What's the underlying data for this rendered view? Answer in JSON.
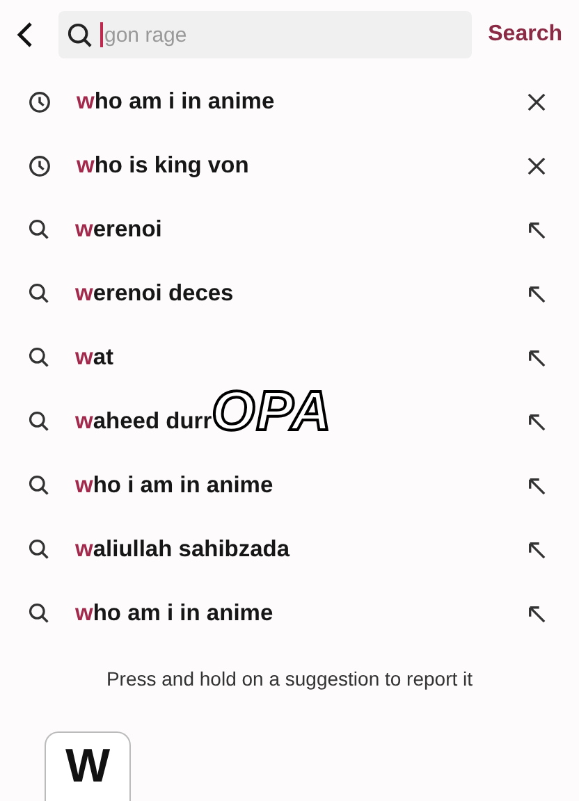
{
  "search": {
    "placeholder": "gon rage",
    "button": "Search"
  },
  "suggestions": [
    {
      "kind": "history",
      "match": "w",
      "rest": "ho am i in anime"
    },
    {
      "kind": "history",
      "match": "w",
      "rest": "ho is king von"
    },
    {
      "kind": "suggestion",
      "match": "w",
      "rest": "erenoi"
    },
    {
      "kind": "suggestion",
      "match": "w",
      "rest": "erenoi deces"
    },
    {
      "kind": "suggestion",
      "match": "w",
      "rest": "at"
    },
    {
      "kind": "suggestion",
      "match": "w",
      "rest": "aheed durr"
    },
    {
      "kind": "suggestion",
      "match": "w",
      "rest": "ho i am in anime"
    },
    {
      "kind": "suggestion",
      "match": "w",
      "rest": "aliullah sahibzada"
    },
    {
      "kind": "suggestion",
      "match": "w",
      "rest": "ho am i in anime"
    }
  ],
  "overlay_caption": "OPA",
  "hint": "Press and hold on a suggestion to report it",
  "keyboard": {
    "key": "W"
  }
}
